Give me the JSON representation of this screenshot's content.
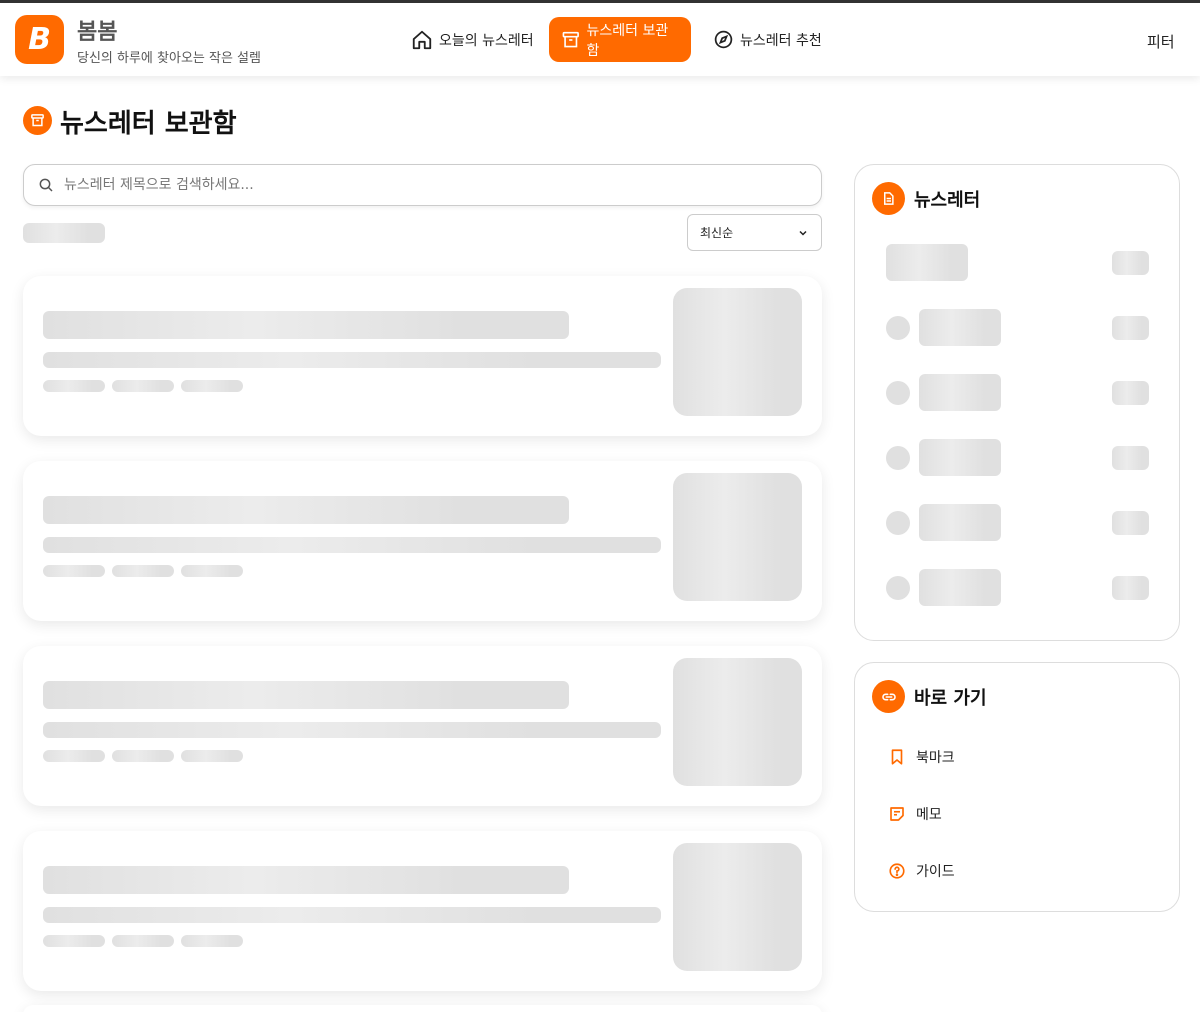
{
  "header": {
    "logo_letter": "B",
    "brand_name": "봄봄",
    "tagline": "당신의 하루에 찾아오는 작은 설렘",
    "nav": [
      {
        "label": "오늘의 뉴스레터",
        "icon": "home-icon"
      },
      {
        "label": "뉴스레터 보관함",
        "icon": "archive-icon"
      },
      {
        "label": "뉴스레터 추천",
        "icon": "compass-icon"
      }
    ],
    "login_label": "피터"
  },
  "page": {
    "title": "뉴스레터 보관함",
    "icon": "archive-icon"
  },
  "search": {
    "placeholder": "뉴스레터 제목으로 검색하세요...",
    "value": ""
  },
  "sort": {
    "selected": "최신순"
  },
  "sidebar": {
    "newsletters": {
      "title": "뉴스레터",
      "icon": "document-icon"
    },
    "shortcuts": {
      "title": "바로 가기",
      "icon": "link-icon",
      "items": [
        {
          "label": "북마크",
          "icon": "bookmark-icon"
        },
        {
          "label": "메모",
          "icon": "memo-icon"
        },
        {
          "label": "가이드",
          "icon": "help-icon"
        }
      ]
    }
  },
  "colors": {
    "accent": "#ff6a00",
    "skeleton": "#e0e0e0"
  }
}
